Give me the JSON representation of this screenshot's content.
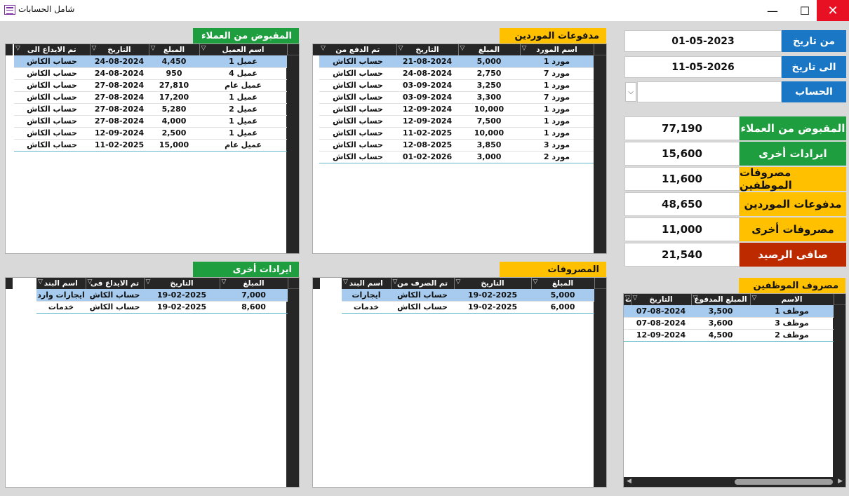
{
  "window": {
    "title": "شامل الحسابات",
    "minimize": "—",
    "maximize": "☐",
    "close": "✕"
  },
  "filters": {
    "from_label": "من تاريخ",
    "from_value": "01-05-2023",
    "to_label": "الى تاريخ",
    "to_value": "11-05-2026",
    "account_label": "الحساب",
    "account_value": ""
  },
  "summary": [
    {
      "label": "المقبوض من العملاء",
      "value": "77,190"
    },
    {
      "label": "ايرادات أخرى",
      "value": "15,600"
    },
    {
      "label": "مصروفات الموظفين",
      "value": "11,600"
    },
    {
      "label": "مدفوعات الموردين",
      "value": "48,650"
    },
    {
      "label": "مصروفات أخرى",
      "value": "11,000"
    },
    {
      "label": "صافى الرصيد",
      "value": "21,540"
    }
  ],
  "colors": {
    "green": "#1f9e40",
    "yellow": "#ffc000",
    "blue": "#1a77c6",
    "red": "#be2a00",
    "selected_row": "#a6cbef",
    "header": "#262626"
  },
  "customers": {
    "title": "المقبوض من العملاء",
    "columns": [
      "اسم العميل",
      "المبلغ",
      "التاريخ",
      "تم الايداع الى"
    ],
    "rows": [
      [
        "عميل 1",
        "4,450",
        "24-08-2024",
        "حساب الكاش"
      ],
      [
        "عميل 4",
        "950",
        "24-08-2024",
        "حساب الكاش"
      ],
      [
        "عميل عام",
        "27,810",
        "27-08-2024",
        "حساب الكاش"
      ],
      [
        "عميل 1",
        "17,200",
        "27-08-2024",
        "حساب الكاش"
      ],
      [
        "عميل 2",
        "5,280",
        "27-08-2024",
        "حساب الكاش"
      ],
      [
        "عميل 1",
        "4,000",
        "27-08-2024",
        "حساب الكاش"
      ],
      [
        "عميل 1",
        "2,500",
        "12-09-2024",
        "حساب الكاش"
      ],
      [
        "عميل عام",
        "15,000",
        "11-02-2025",
        "حساب الكاش"
      ]
    ]
  },
  "suppliers": {
    "title": "مدفوعات الموردين",
    "columns": [
      "اسم المورد",
      "المبلغ",
      "التاريخ",
      "تم الدفع من"
    ],
    "rows": [
      [
        "مورد 1",
        "5,000",
        "21-08-2024",
        "حساب الكاش"
      ],
      [
        "مورد 7",
        "2,750",
        "24-08-2024",
        "حساب الكاش"
      ],
      [
        "مورد 1",
        "3,250",
        "03-09-2024",
        "حساب الكاش"
      ],
      [
        "مورد 7",
        "3,300",
        "03-09-2024",
        "حساب الكاش"
      ],
      [
        "مورد 1",
        "10,000",
        "12-09-2024",
        "حساب الكاش"
      ],
      [
        "مورد 1",
        "7,500",
        "12-09-2024",
        "حساب الكاش"
      ],
      [
        "مورد 1",
        "10,000",
        "11-02-2025",
        "حساب الكاش"
      ],
      [
        "مورد 3",
        "3,850",
        "12-08-2025",
        "حساب الكاش"
      ],
      [
        "مورد 2",
        "3,000",
        "01-02-2026",
        "حساب الكاش"
      ]
    ]
  },
  "other_income": {
    "title": "ايرادات أخرى",
    "columns": [
      "المبلغ",
      "التاريخ",
      "تم الايداع فى",
      "اسم البند"
    ],
    "rows": [
      [
        "7,000",
        "19-02-2025",
        "حساب الكاش",
        "ايجارات وارد"
      ],
      [
        "8,600",
        "19-02-2025",
        "حساب الكاش",
        "خدمات"
      ]
    ]
  },
  "expenses": {
    "title": "المصروفات",
    "columns": [
      "المبلغ",
      "التاريخ",
      "تم الصرف من",
      "اسم البند"
    ],
    "rows": [
      [
        "5,000",
        "19-02-2025",
        "حساب الكاش",
        "ايجارات"
      ],
      [
        "6,000",
        "19-02-2025",
        "حساب الكاش",
        "خدمات"
      ]
    ]
  },
  "employees": {
    "title": "مصروف الموظفين",
    "columns": [
      "الاسم",
      "المبلغ المدفوع",
      "التاريخ",
      "ت"
    ],
    "rows": [
      [
        "موظف 1",
        "3,500",
        "07-08-2024"
      ],
      [
        "موظف 3",
        "3,600",
        "07-08-2024"
      ],
      [
        "موظف 2",
        "4,500",
        "12-09-2024"
      ]
    ]
  }
}
